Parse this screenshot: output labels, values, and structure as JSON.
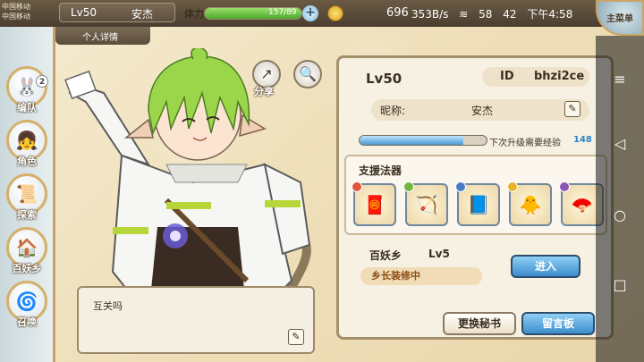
{
  "status_bar": {
    "carrier_1": "中国移动",
    "carrier_2": "中国移动",
    "level": "Lv50",
    "player_name": "安杰",
    "stamina_label": "体力",
    "stamina_text": "157/89",
    "stamina_fraction": 1.0,
    "gold": "696",
    "net_speed": "353B/s",
    "signal": "58",
    "battery": "42",
    "time": "下午4:58",
    "menu_label": "主菜单"
  },
  "tab": {
    "label": "个人详情"
  },
  "sidebar": {
    "items": [
      {
        "label": "编队",
        "icon": "rabbit-icon",
        "badge": "2"
      },
      {
        "label": "角色",
        "icon": "girl-icon"
      },
      {
        "label": "探索",
        "icon": "map-scroll-icon"
      },
      {
        "label": "百妖乡",
        "icon": "house-icon"
      },
      {
        "label": "召唤",
        "icon": "summon-swirl-icon"
      }
    ]
  },
  "actions": {
    "share_label": "分享"
  },
  "chat": {
    "text": "互关吗"
  },
  "profile": {
    "level": "Lv50",
    "id_label": "ID",
    "id_value": "bhzi2ce",
    "nickname_label": "昵称:",
    "nickname_value": "安杰",
    "exp_fraction": 0.82,
    "exp_label": "下次升级需要经验",
    "exp_value": "148",
    "support_title": "支援法器",
    "support_items": [
      {
        "icon": "red-scroll-icon",
        "dot_color": "#e2533a"
      },
      {
        "icon": "crossbow-icon",
        "dot_color": "#73b43e"
      },
      {
        "icon": "blue-scroll-icon",
        "dot_color": "#4a79c6"
      },
      {
        "icon": "yellow-bird-icon",
        "dot_color": "#e6b52c"
      },
      {
        "icon": "red-fan-icon",
        "dot_color": "#8e57b6"
      }
    ],
    "village_name": "百妖乡",
    "village_level": "Lv5",
    "village_status": "乡长装修中",
    "enter_label": "进入",
    "secretary_label": "更换秘书",
    "message_label": "留言板"
  },
  "colors": {
    "accent_blue": "#3c8ccc",
    "frame_gold": "#c7a466",
    "text_dark": "#3a2e1f",
    "exp_value": "#2a86c7"
  }
}
